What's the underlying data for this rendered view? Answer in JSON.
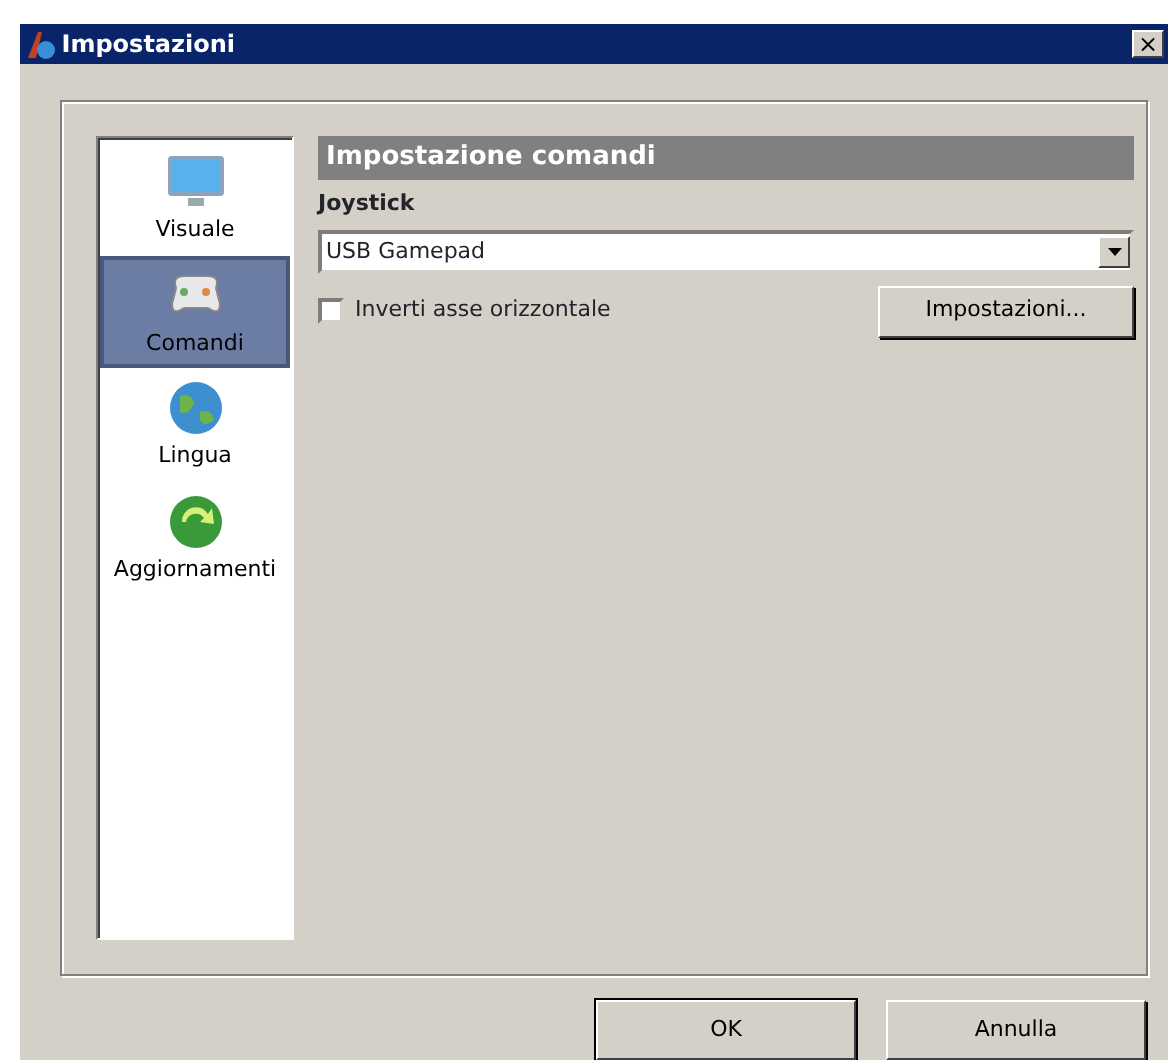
{
  "window": {
    "title": "Impostazioni",
    "close": "×"
  },
  "sidebar": {
    "items": [
      {
        "label": "Visuale",
        "kind": "monitor",
        "selected": false
      },
      {
        "label": "Comandi",
        "kind": "gamepad",
        "selected": true
      },
      {
        "label": "Lingua",
        "kind": "globe",
        "selected": false
      },
      {
        "label": "Aggiornamenti",
        "kind": "update",
        "selected": false
      }
    ]
  },
  "section": {
    "title": "Impostazione comandi",
    "label": "Joystick",
    "device": "USB Gamepad",
    "invert": {
      "label": "Inverti asse orizzontale",
      "checked": false
    },
    "settings_button": "Impostazioni..."
  },
  "buttons": [
    "OK",
    "Annulla"
  ]
}
